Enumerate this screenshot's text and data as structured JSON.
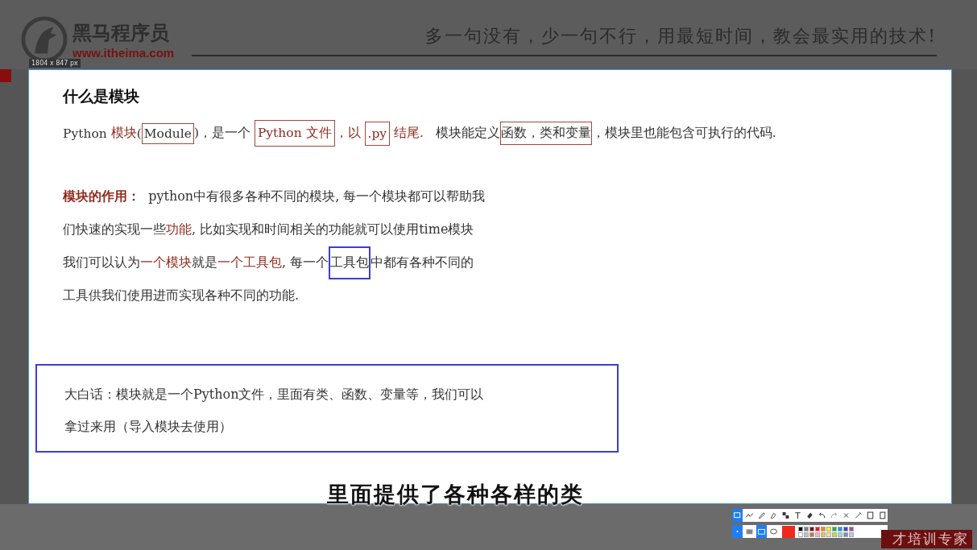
{
  "header": {
    "logo_text": "黑马程序员",
    "logo_url": "www.itheima.com",
    "slogan": "多一句没有，少一句不行，用最短时间，教会最实用的技术!"
  },
  "capture": {
    "size_label": "1804 x 847  px"
  },
  "slide": {
    "title": "什么是模块",
    "intro": [
      {
        "text": "Python ",
        "kind": "plain"
      },
      {
        "text": "模块",
        "kind": "accent"
      },
      {
        "text": "(",
        "kind": "plain"
      },
      {
        "text": "Module",
        "kind": "boxed"
      },
      {
        "text": ")，是一个 ",
        "kind": "plain"
      },
      {
        "text": "Python 文件",
        "kind": "boxed-accent"
      },
      {
        "text": "，以 ",
        "kind": "accent"
      },
      {
        "text": ".py",
        "kind": "boxed-accent"
      },
      {
        "text": " 结尾.",
        "kind": "accent"
      },
      {
        "text": "   模块能定义",
        "kind": "plain"
      },
      {
        "text": "函数，类和变量",
        "kind": "selected-box"
      },
      {
        "text": "，模块里也能包含可执行的代码.",
        "kind": "plain"
      }
    ],
    "body": [
      [
        {
          "text": "模块的作用：",
          "kind": "label"
        },
        {
          "text": "  python中有很多各种不同的模块, 每一个模块都可以帮助我",
          "kind": "plain"
        }
      ],
      [
        {
          "text": "们快速的实现一些",
          "kind": "plain"
        },
        {
          "text": "功能",
          "kind": "accent"
        },
        {
          "text": ", 比如实现和时间相关的功能就可以使用time模块",
          "kind": "plain"
        }
      ],
      [
        {
          "text": "我们可以认为",
          "kind": "plain"
        },
        {
          "text": "一个模块",
          "kind": "accent"
        },
        {
          "text": "就是",
          "kind": "plain"
        },
        {
          "text": "一个工具包",
          "kind": "accent"
        },
        {
          "text": ", 每一个",
          "kind": "plain"
        },
        {
          "text": "工具包",
          "kind": "blue-box"
        },
        {
          "text": "中都有各种不同的",
          "kind": "plain"
        }
      ],
      [
        {
          "text": "工具供我们使用进而实现各种不同的功能.",
          "kind": "plain"
        }
      ]
    ],
    "summary": [
      "大白话：模块就是一个Python文件，里面有类、函数、变量等，我们可以",
      "拿过来用（导入模块去使用）"
    ]
  },
  "subtitle": "里面提供了各种各样的类",
  "toolbar": {
    "palette": [
      {
        "color": "#000000",
        "selected": false
      },
      {
        "color": "#7f7f7f",
        "selected": false
      },
      {
        "color": "#880015",
        "selected": false
      },
      {
        "color": "#ed1c24",
        "selected": false
      },
      {
        "color": "#ff7f27",
        "selected": false
      },
      {
        "color": "#fff200",
        "selected": false
      },
      {
        "color": "#22b14c",
        "selected": false
      },
      {
        "color": "#00a2e8",
        "selected": false
      },
      {
        "color": "#3f48cc",
        "selected": false
      },
      {
        "color": "#a349a4",
        "selected": false
      },
      {
        "color": "#ffffff",
        "selected": false
      },
      {
        "color": "#c3c3c3",
        "selected": false
      },
      {
        "color": "#b97a57",
        "selected": false
      },
      {
        "color": "#ffaec9",
        "selected": false
      },
      {
        "color": "#ffc90e",
        "selected": false
      },
      {
        "color": "#efe4b0",
        "selected": false
      },
      {
        "color": "#b5e61d",
        "selected": false
      },
      {
        "color": "#99d9ea",
        "selected": false
      },
      {
        "color": "#7092be",
        "selected": false
      },
      {
        "color": "#c8bfe7",
        "selected": false
      }
    ]
  },
  "footer": {
    "banner_text": "才培训专家"
  }
}
